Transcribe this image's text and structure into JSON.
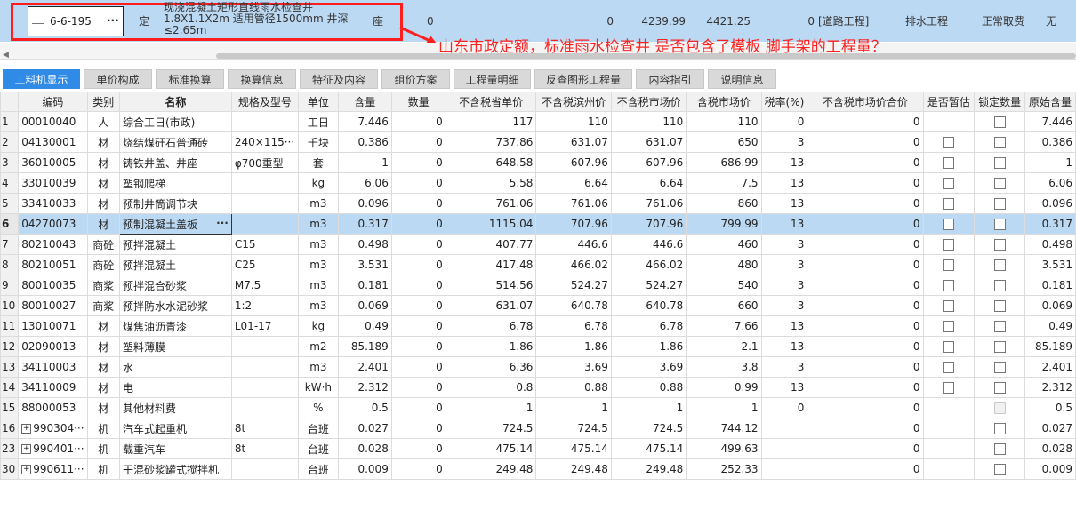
{
  "top_row": {
    "code": "6-6-195",
    "ellipsis": "···",
    "type": "定",
    "name_line1": "现浇混凝土矩形直线雨水检查井",
    "name_line2": "1.8X1.1X2m 适用管径1500mm 井深",
    "name_line3": "≤2.65m",
    "unit": "座",
    "qty_expr": "0",
    "qty": "0",
    "price1": "4239.99",
    "price2": "4421.25",
    "val": "0",
    "category": "[道路工程]",
    "subcategory": "排水工程",
    "fee": "正常取费",
    "none": "无"
  },
  "annotation": "山东市政定额，标准雨水检查井 是否包含了模板 脚手架的工程量？",
  "tabs": [
    {
      "label": "工料机显示",
      "active": true
    },
    {
      "label": "单价构成"
    },
    {
      "label": "标准换算"
    },
    {
      "label": "换算信息"
    },
    {
      "label": "特征及内容"
    },
    {
      "label": "组价方案"
    },
    {
      "label": "工程量明细"
    },
    {
      "label": "反查图形工程量"
    },
    {
      "label": "内容指引"
    },
    {
      "label": "说明信息"
    }
  ],
  "columns": [
    "",
    "编码",
    "类别",
    "名称",
    "规格及型号",
    "单位",
    "含量",
    "数量",
    "不含税省单价",
    "不含税滨州价",
    "不含税市场价",
    "含税市场价",
    "税率(%)",
    "不含税市场价合价",
    "是否暂估",
    "锁定数量",
    "原始含量"
  ],
  "rows": [
    {
      "rn": "1",
      "code": "00010040",
      "type": "人",
      "name": "综合工日(市政)",
      "spec": "",
      "unit": "工日",
      "content": "7.446",
      "qty": "0",
      "p1": "117",
      "p2": "110",
      "p3": "110",
      "p4": "110",
      "tax": "0",
      "total": "0",
      "est": "none",
      "lock": "cb",
      "orig": "7.446"
    },
    {
      "rn": "2",
      "code": "04130001",
      "type": "材",
      "name": "烧结煤矸石普通砖",
      "spec": "240×115···",
      "unit": "千块",
      "content": "0.386",
      "qty": "0",
      "p1": "737.86",
      "p2": "631.07",
      "p3": "631.07",
      "p4": "650",
      "tax": "3",
      "total": "0",
      "est": "cb",
      "lock": "cb",
      "orig": "0.386"
    },
    {
      "rn": "3",
      "code": "36010005",
      "type": "材",
      "name": "铸铁井盖、井座",
      "spec": "φ700重型",
      "unit": "套",
      "content": "1",
      "qty": "0",
      "p1": "648.58",
      "p2": "607.96",
      "p3": "607.96",
      "p4": "686.99",
      "tax": "13",
      "total": "0",
      "est": "cb",
      "lock": "cb",
      "orig": "1"
    },
    {
      "rn": "4",
      "code": "33010039",
      "type": "材",
      "name": "塑钢爬梯",
      "spec": "",
      "unit": "kg",
      "content": "6.06",
      "qty": "0",
      "p1": "5.58",
      "p2": "6.64",
      "p3": "6.64",
      "p4": "7.5",
      "tax": "13",
      "total": "0",
      "est": "cb",
      "lock": "cb",
      "orig": "6.06"
    },
    {
      "rn": "5",
      "code": "33410033",
      "type": "材",
      "name": "预制井筒调节块",
      "spec": "",
      "unit": "m3",
      "content": "0.096",
      "qty": "0",
      "p1": "761.06",
      "p2": "761.06",
      "p3": "761.06",
      "p4": "860",
      "tax": "13",
      "total": "0",
      "est": "cb",
      "lock": "cb",
      "orig": "0.096"
    },
    {
      "rn": "6",
      "code": "04270073",
      "type": "材",
      "name": "预制混凝土盖板",
      "spec": "",
      "unit": "m3",
      "content": "0.317",
      "qty": "0",
      "p1": "1115.04",
      "p2": "707.96",
      "p3": "707.96",
      "p4": "799.99",
      "tax": "13",
      "total": "0",
      "est": "cb",
      "lock": "cb",
      "orig": "0.317",
      "selected": true
    },
    {
      "rn": "7",
      "code": "80210043",
      "type": "商砼",
      "name": "预拌混凝土",
      "spec": "C15",
      "unit": "m3",
      "content": "0.498",
      "qty": "0",
      "p1": "407.77",
      "p2": "446.6",
      "p3": "446.6",
      "p4": "460",
      "tax": "3",
      "total": "0",
      "est": "cb",
      "lock": "cb",
      "orig": "0.498"
    },
    {
      "rn": "8",
      "code": "80210051",
      "type": "商砼",
      "name": "预拌混凝土",
      "spec": "C25",
      "unit": "m3",
      "content": "3.531",
      "qty": "0",
      "p1": "417.48",
      "p2": "466.02",
      "p3": "466.02",
      "p4": "480",
      "tax": "3",
      "total": "0",
      "est": "cb",
      "lock": "cb",
      "orig": "3.531"
    },
    {
      "rn": "9",
      "code": "80010035",
      "type": "商浆",
      "name": "预拌混合砂浆",
      "spec": "M7.5",
      "unit": "m3",
      "content": "0.181",
      "qty": "0",
      "p1": "514.56",
      "p2": "524.27",
      "p3": "524.27",
      "p4": "540",
      "tax": "3",
      "total": "0",
      "est": "cb",
      "lock": "cb",
      "orig": "0.181"
    },
    {
      "rn": "10",
      "code": "80010027",
      "type": "商浆",
      "name": "预拌防水水泥砂浆",
      "spec": "1:2",
      "unit": "m3",
      "content": "0.069",
      "qty": "0",
      "p1": "631.07",
      "p2": "640.78",
      "p3": "640.78",
      "p4": "660",
      "tax": "3",
      "total": "0",
      "est": "cb",
      "lock": "cb",
      "orig": "0.069"
    },
    {
      "rn": "11",
      "code": "13010071",
      "type": "材",
      "name": "煤焦油沥青漆",
      "spec": "L01-17",
      "unit": "kg",
      "content": "0.49",
      "qty": "0",
      "p1": "6.78",
      "p2": "6.78",
      "p3": "6.78",
      "p4": "7.66",
      "tax": "13",
      "total": "0",
      "est": "cb",
      "lock": "cb",
      "orig": "0.49"
    },
    {
      "rn": "12",
      "code": "02090013",
      "type": "材",
      "name": "塑料薄膜",
      "spec": "",
      "unit": "m2",
      "content": "85.189",
      "qty": "0",
      "p1": "1.86",
      "p2": "1.86",
      "p3": "1.86",
      "p4": "2.1",
      "tax": "13",
      "total": "0",
      "est": "cb",
      "lock": "cb",
      "orig": "85.189"
    },
    {
      "rn": "13",
      "code": "34110003",
      "type": "材",
      "name": "水",
      "spec": "",
      "unit": "m3",
      "content": "2.401",
      "qty": "0",
      "p1": "6.36",
      "p2": "3.69",
      "p3": "3.69",
      "p4": "3.8",
      "tax": "3",
      "total": "0",
      "est": "cb",
      "lock": "cb",
      "orig": "2.401"
    },
    {
      "rn": "14",
      "code": "34110009",
      "type": "材",
      "name": "电",
      "spec": "",
      "unit": "kW·h",
      "content": "2.312",
      "qty": "0",
      "p1": "0.8",
      "p2": "0.88",
      "p3": "0.88",
      "p4": "0.99",
      "tax": "13",
      "total": "0",
      "est": "cb",
      "lock": "cb",
      "orig": "2.312"
    },
    {
      "rn": "15",
      "code": "88000053",
      "type": "材",
      "name": "其他材料费",
      "spec": "",
      "unit": "%",
      "content": "0.5",
      "qty": "0",
      "p1": "1",
      "p2": "1",
      "p3": "1",
      "p4": "1",
      "tax": "0",
      "total": "0",
      "est": "none",
      "lock": "dis",
      "orig": "0.5"
    },
    {
      "rn": "16",
      "code": "990304···",
      "type": "机",
      "name": "汽车式起重机",
      "spec": "8t",
      "unit": "台班",
      "content": "0.027",
      "qty": "0",
      "p1": "724.5",
      "p2": "724.5",
      "p3": "724.5",
      "p4": "744.12",
      "tax": "",
      "total": "0",
      "est": "none",
      "lock": "cb",
      "orig": "0.027",
      "plus": true
    },
    {
      "rn": "23",
      "code": "990401···",
      "type": "机",
      "name": "载重汽车",
      "spec": "8t",
      "unit": "台班",
      "content": "0.028",
      "qty": "0",
      "p1": "475.14",
      "p2": "475.14",
      "p3": "475.14",
      "p4": "499.63",
      "tax": "",
      "total": "0",
      "est": "none",
      "lock": "cb",
      "orig": "0.028",
      "plus": true
    },
    {
      "rn": "30",
      "code": "990611···",
      "type": "机",
      "name": "干混砂浆罐式搅拌机",
      "spec": "",
      "unit": "台班",
      "content": "0.009",
      "qty": "0",
      "p1": "249.48",
      "p2": "249.48",
      "p3": "249.48",
      "p4": "252.33",
      "tax": "",
      "total": "0",
      "est": "none",
      "lock": "cb",
      "orig": "0.009",
      "plus": true
    }
  ],
  "colors": {
    "accent": "#2f8be6",
    "selection": "#bcd9f3",
    "annotation": "#ff2020"
  }
}
